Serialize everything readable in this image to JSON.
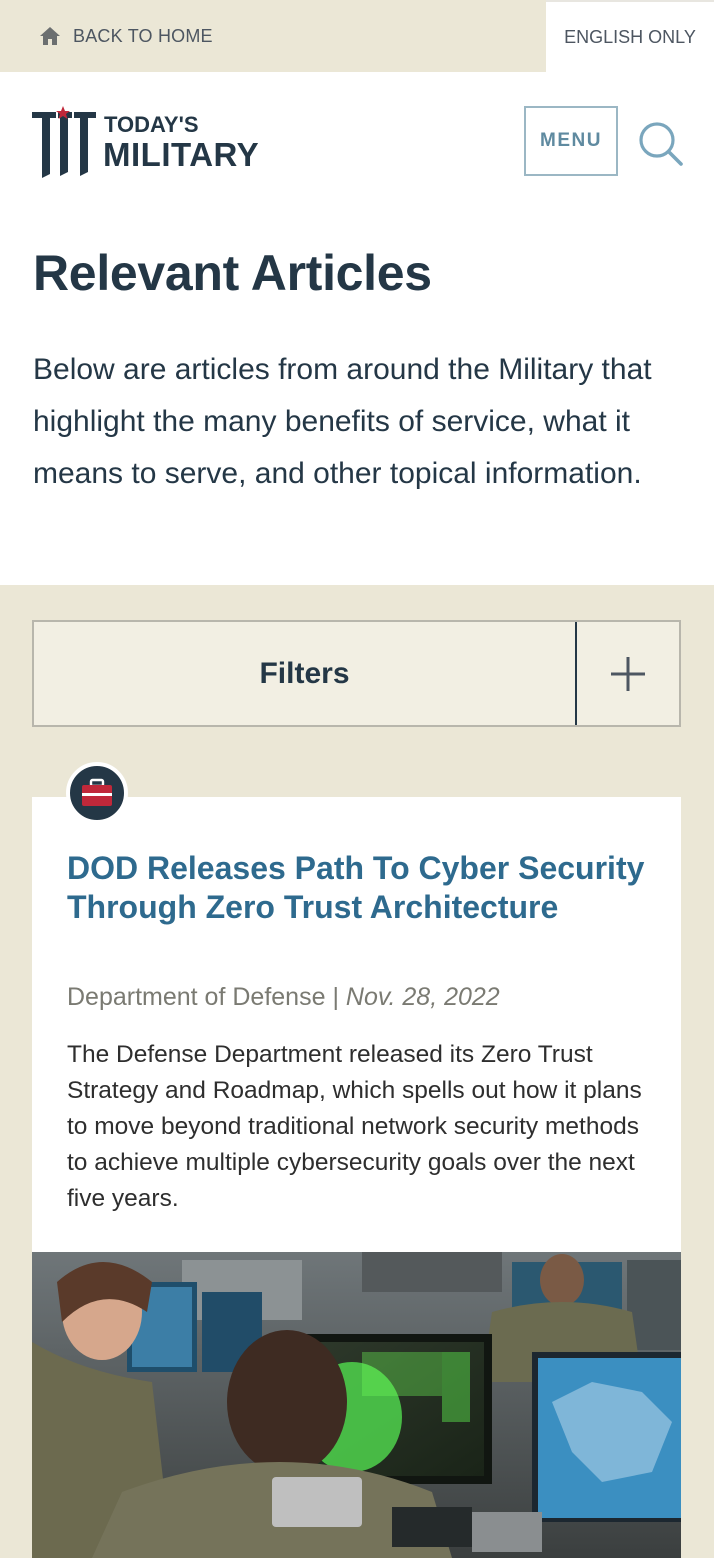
{
  "topbar": {
    "back_label": "BACK TO HOME",
    "language_label": "ENGLISH ONLY"
  },
  "header": {
    "logo_line1": "TODAY'S",
    "logo_line2": "MILITARY",
    "menu_label": "MENU",
    "search_icon": "search-icon"
  },
  "page": {
    "title": "Relevant Articles",
    "intro": "Below are articles from around the Military that highlight the many benefits of service, what it means to serve, and other topical information."
  },
  "filters": {
    "label": "Filters",
    "toggle_icon": "plus-icon"
  },
  "articles": [
    {
      "category_icon": "briefcase-icon",
      "title": "DOD Releases Path To Cyber Security Through Zero Trust Architecture",
      "source": "Department of Defense",
      "separator": "|",
      "date": "Nov. 28, 2022",
      "excerpt": "The Defense Department released its Zero Trust Strategy and Roadmap, which spells out how it plans to move beyond traditional network security methods to achieve multiple cybersecurity goals over the next five years."
    }
  ],
  "colors": {
    "navy": "#243746",
    "beige": "#ebe7d6",
    "link_blue": "#2e6a8e",
    "accent_red": "#c0283a",
    "menu_border": "#9bb7c4"
  }
}
